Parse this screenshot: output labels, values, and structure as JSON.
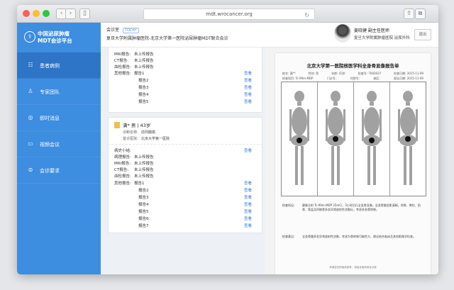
{
  "browser": {
    "url": "mdt.wrocancer.org"
  },
  "brand": {
    "title": "中国泌尿肿瘤",
    "subtitle": "MDT会诊平台"
  },
  "sidebar": {
    "items": [
      {
        "label": "患者病例",
        "icon": "case-icon"
      },
      {
        "label": "专家团队",
        "icon": "experts-icon"
      },
      {
        "label": "即时消息",
        "icon": "message-icon"
      },
      {
        "label": "视频会议",
        "icon": "video-icon"
      },
      {
        "label": "会诊要求",
        "icon": "request-icon"
      }
    ]
  },
  "header": {
    "room_label": "会诊室",
    "room_tag": "TODAY",
    "room_name": "复旦大学附属肿瘤医院-北京大学第一医院泌尿肿瘤MDT联合会诊",
    "doctor_name": "姜晓健  副主任医师",
    "doctor_hospital": "复旦大学附属肿瘤医院 泌尿外科",
    "logout_label": "退出"
  },
  "case1": {
    "rows": [
      {
        "label": "MRI报告:",
        "value": "未上传报告"
      },
      {
        "label": "CT报告:",
        "value": "未上传报告"
      },
      {
        "label": "血检报告:",
        "value": "未上传报告"
      },
      {
        "label": "其他报告:",
        "value": "报告1",
        "link": "查看"
      }
    ],
    "reports": [
      {
        "value": "报告2",
        "link": "查看"
      },
      {
        "value": "报告3",
        "link": "查看"
      },
      {
        "value": "报告4",
        "link": "查看"
      },
      {
        "value": "报告5",
        "link": "查看"
      }
    ]
  },
  "patient": {
    "title": "满* 男 | 43岁",
    "rows": [
      {
        "label": "诊断名称:",
        "value": "前列腺癌"
      },
      {
        "label": "首诊医院:",
        "value": "北京大学第一医院"
      }
    ]
  },
  "case2": {
    "summary_label": "病史小结:",
    "summary_link": "查看",
    "rows": [
      {
        "label": "病理报告:",
        "value": "未上传报告"
      },
      {
        "label": "MRI报告:",
        "value": "未上传报告"
      },
      {
        "label": "CT报告:",
        "value": "未上传报告"
      },
      {
        "label": "血检报告:",
        "value": "未上传报告"
      },
      {
        "label": "其他报告:",
        "value": "报告1",
        "link": "查看"
      }
    ],
    "reports": [
      {
        "value": "报告2",
        "link": "查看"
      },
      {
        "value": "报告3",
        "link": "查看"
      },
      {
        "value": "报告4",
        "link": "查看"
      },
      {
        "value": "报告5",
        "link": "查看"
      },
      {
        "value": "报告6",
        "link": "查看"
      },
      {
        "value": "报告7",
        "link": "查看"
      }
    ]
  },
  "document": {
    "title": "北京大学第一医院核医学科全身骨显像报告单",
    "meta1": [
      "姓名: 满**",
      "性别: 男",
      "年龄: 43岁",
      "检查号: 7083937",
      "检查日期: 2015-11-09"
    ],
    "meta2": [
      "检查项目: Tc-99m-MDP",
      "门诊号:",
      "住院号:",
      "病区:",
      "报告日期: 2015-11-09"
    ],
    "findings_label": "检查所见:",
    "findings": "静脉注射 Tc-99m-MDP 25mCi，3小时后行全身骨显像。全身骨骼显影清晰，颅骨、脊柱、肋骨、骨盆及四肢骨多发异常放射性浓聚灶，考虑多发骨转移。",
    "conclusion_label": "检查意见:",
    "conclusion": "全身骨骼多发异常放射性浓聚，考虑为骨转移可能性大，建议结合临床及其他影像学检查。",
    "footer": "本报告仅供临床参考，请结合临床综合分析"
  }
}
